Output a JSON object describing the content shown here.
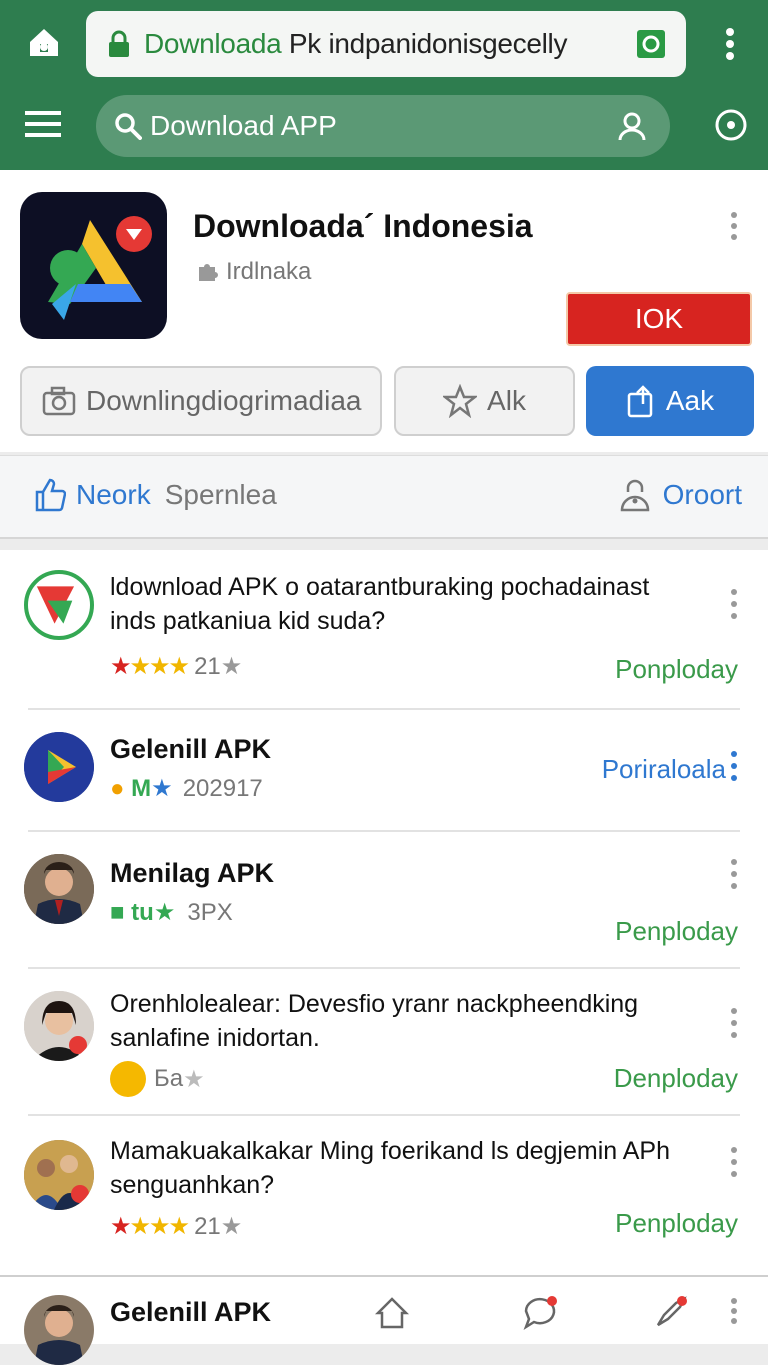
{
  "browser": {
    "url_highlight": "Downloada",
    "url_rest": " Pk indpanidonisgecelly",
    "search_placeholder": "Download APP"
  },
  "app": {
    "title": "Downloada´ Indonesia",
    "developer": "Irdlnaka",
    "primary_button": "IOK",
    "actions": [
      {
        "label": "Downlingdiogrimadiaa",
        "icon": "camera-icon"
      },
      {
        "label": "Alk",
        "icon": "star-icon"
      },
      {
        "label": "Aak",
        "icon": "share-icon"
      }
    ]
  },
  "sortbar": {
    "label1": "Neork",
    "label2": "Spernlea",
    "right_label": "Oroort"
  },
  "list": [
    {
      "title": "ldownload APK o oatarantburaking pochadainast inds patkaniua kid suda?",
      "meta": "21",
      "meta_icon": "rating-stars",
      "action": "Ponploday",
      "action_color": "#3a9a4a"
    },
    {
      "title": "Gelenill APK",
      "meta": "202917",
      "meta_icon": "badge-icons",
      "action": "Poriraloala",
      "action_color": "#2f78d0"
    },
    {
      "title": "Menilag APK",
      "meta": "3PX",
      "meta_icon": "badge-icons",
      "action": "Penploday",
      "action_color": "#3a9a4a"
    },
    {
      "title": "Orenhlolealear: Devesfio yranr nackpheendking sanlafine inidortan.",
      "meta": "Бa",
      "meta_icon": "emoji-icon",
      "action": "Denploday",
      "action_color": "#3a9a4a"
    },
    {
      "title": "Mamakuakalkakar Ming foerikand ls degjemin APh senguanhkan?",
      "meta": "21",
      "meta_icon": "rating-stars",
      "action": "Penploday",
      "action_color": "#3a9a4a"
    }
  ],
  "bottom": {
    "title": "Gelenill APK"
  },
  "colors": {
    "header_green": "#2e7d4f",
    "accent_blue": "#2f78d0",
    "ok_red": "#d72420",
    "action_green": "#3a9a4a"
  }
}
